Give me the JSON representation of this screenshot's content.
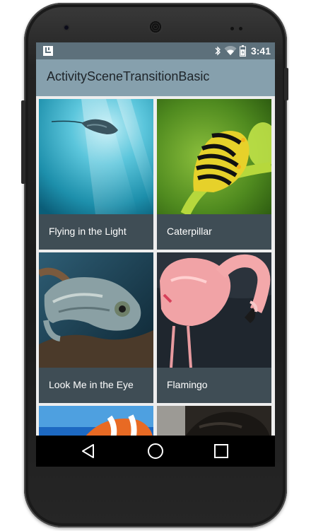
{
  "status_bar": {
    "time": "3:41",
    "icons": [
      "app-notification-icon",
      "bluetooth-icon",
      "wifi-icon",
      "battery-icon"
    ]
  },
  "app_bar": {
    "title": "ActivitySceneTransitionBasic"
  },
  "grid": {
    "items": [
      {
        "caption": "Flying in the Light",
        "image": "manta-ray-photo"
      },
      {
        "caption": "Caterpillar",
        "image": "caterpillar-photo"
      },
      {
        "caption": "Look Me in the Eye",
        "image": "chameleon-photo"
      },
      {
        "caption": "Flamingo",
        "image": "flamingo-photo"
      },
      {
        "caption": "",
        "image": "clownfish-photo"
      },
      {
        "caption": "",
        "image": "gorilla-photo"
      }
    ]
  },
  "nav_bar": {
    "icons": [
      "back-icon",
      "home-icon",
      "recents-icon"
    ]
  },
  "colors": {
    "status_bar": "#5d707b",
    "app_bar": "#86a0ad",
    "caption_bar": "#3f4d55",
    "nav_bar": "#000000"
  }
}
